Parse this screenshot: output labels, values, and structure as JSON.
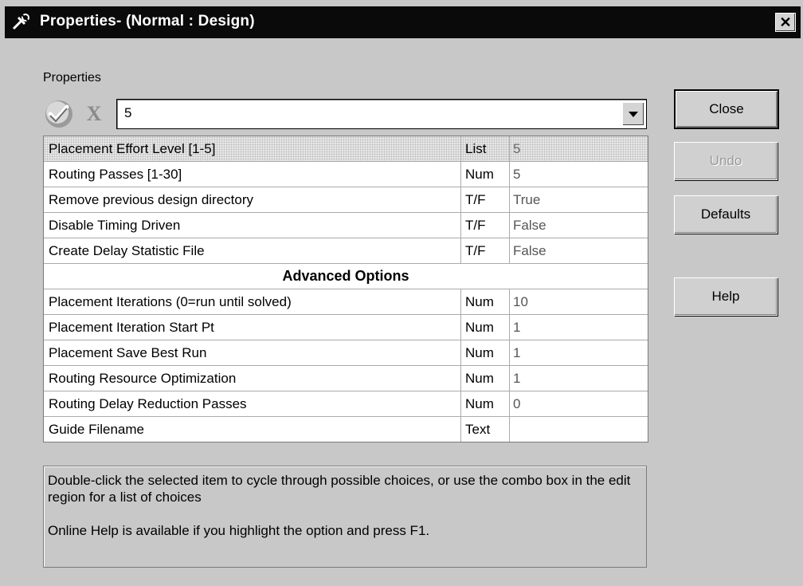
{
  "window": {
    "title": "Properties- (Normal : Design)",
    "close_glyph": "✕"
  },
  "group_label": "Properties",
  "editor": {
    "accept_icon": "checkmark-icon",
    "cancel_icon": "x-icon",
    "cancel_glyph": "X",
    "value": "5"
  },
  "rows": [
    {
      "name": "Placement Effort Level [1-5]",
      "type": "List",
      "value": "5",
      "selected": true
    },
    {
      "name": "Routing Passes [1-30]",
      "type": "Num",
      "value": "5"
    },
    {
      "name": "Remove previous design directory",
      "type": "T/F",
      "value": "True"
    },
    {
      "name": "Disable Timing Driven",
      "type": "T/F",
      "value": "False"
    },
    {
      "name": "Create Delay Statistic File",
      "type": "T/F",
      "value": "False"
    },
    {
      "section": "Advanced Options"
    },
    {
      "name": "Placement Iterations (0=run until solved)",
      "type": "Num",
      "value": "10"
    },
    {
      "name": "Placement Iteration Start Pt",
      "type": "Num",
      "value": "1"
    },
    {
      "name": "Placement Save Best Run",
      "type": "Num",
      "value": "1"
    },
    {
      "name": "Routing Resource Optimization",
      "type": "Num",
      "value": "1"
    },
    {
      "name": "Routing Delay Reduction Passes",
      "type": "Num",
      "value": "0"
    },
    {
      "name": "Guide Filename",
      "type": "Text",
      "value": ""
    }
  ],
  "buttons": {
    "close": "Close",
    "undo": "Undo",
    "defaults": "Defaults",
    "help": "Help"
  },
  "description": {
    "line1": "Double-click the selected item to cycle through possible choices, or use the combo box in the edit region for a list of choices",
    "line2": "Online Help is available if you highlight the option and press F1."
  }
}
